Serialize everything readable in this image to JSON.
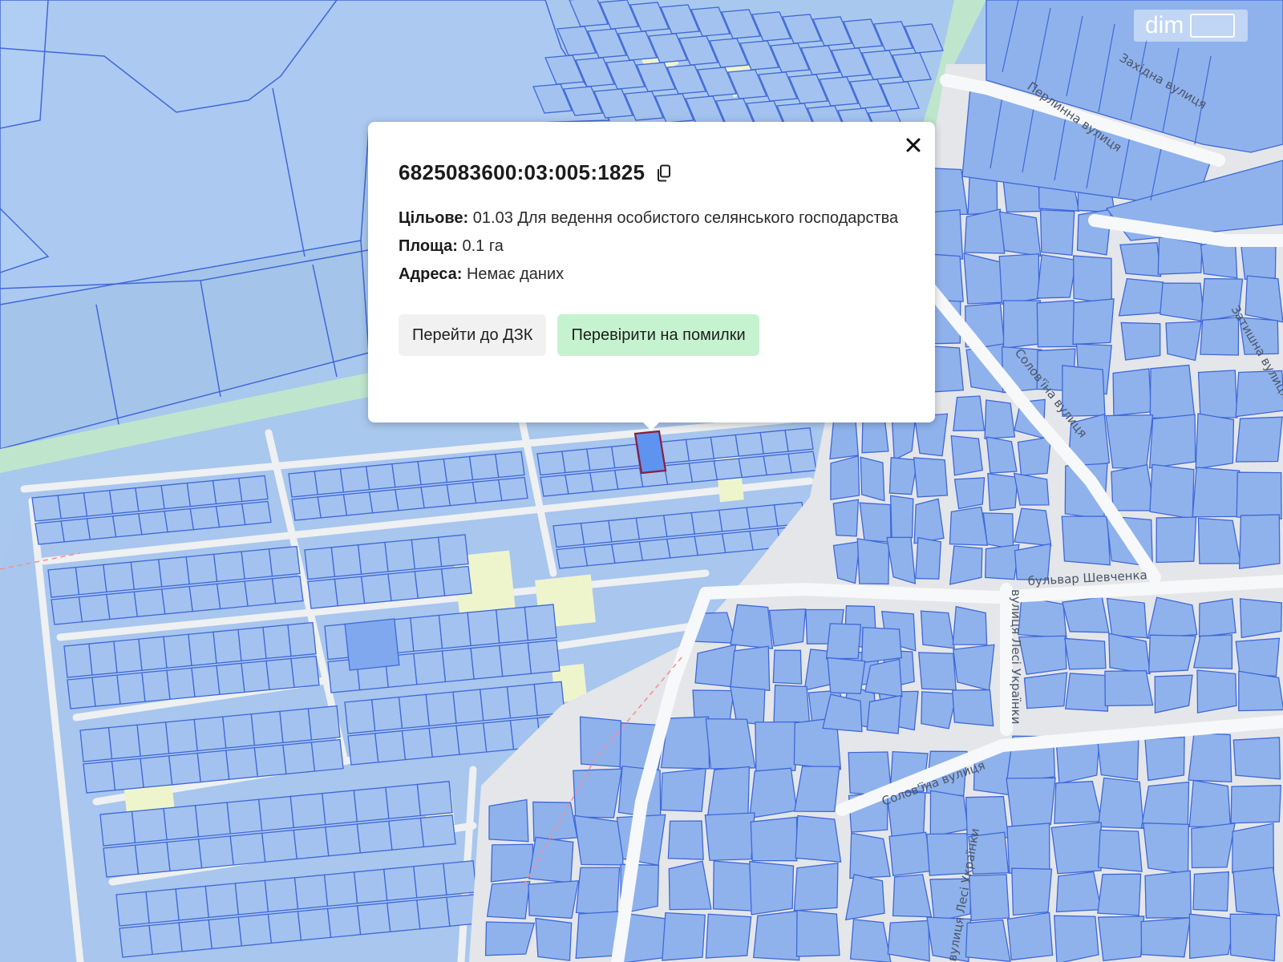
{
  "parcel": {
    "cadastral_number": "6825083600:03:005:1825",
    "purpose_label": "Цільове:",
    "purpose_value": "01.03 Для ведення особистого селянського господарства",
    "area_label": "Площа:",
    "area_value": "0.1 га",
    "address_label": "Адреса:",
    "address_value": "Немає даних"
  },
  "buttons": {
    "dzk_label": "Перейти до ДЗК",
    "check_label": "Перевірити на помилки"
  },
  "watermark": {
    "text": "dim"
  },
  "streets": [
    "Західна вулиця",
    "Перлинна вулиця",
    "Затишна вулиця",
    "Солов'їна вулиця",
    "бульвар Шевченка",
    "вулиця Лесі Українки",
    "Солов'їна вулиця",
    "вулиця Лесі Українки"
  ],
  "icons": {
    "close": "close-icon",
    "copy": "copy-icon"
  },
  "colors": {
    "parcel_fill": "#8fb2ec",
    "parcel_stroke": "#3f68d8",
    "road": "#e9ecf0",
    "green_strip": "#bfe6cc",
    "selected_parcel": "#5e93f0",
    "selected_outline": "#8a1f3c",
    "button_green": "#c6f3cf"
  }
}
